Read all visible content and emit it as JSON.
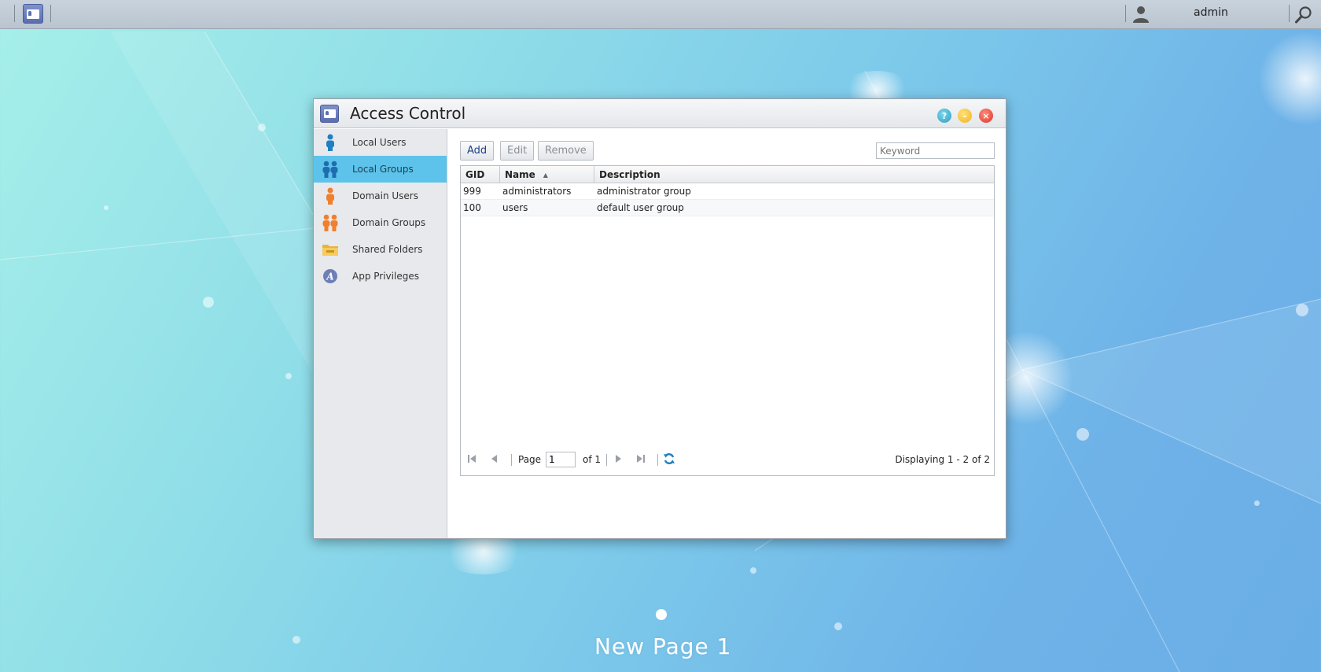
{
  "taskbar": {
    "username": "admin",
    "app_icon": "access-control-icon",
    "user_icon": "user-icon",
    "search_icon": "search-icon"
  },
  "window": {
    "title": "Access Control",
    "controls": [
      "help",
      "minimize",
      "close"
    ]
  },
  "sidebar": {
    "items": [
      {
        "label": "Local Users",
        "icon": "user-icon",
        "active": false
      },
      {
        "label": "Local Groups",
        "icon": "group-icon",
        "active": true
      },
      {
        "label": "Domain Users",
        "icon": "domain-user-icon",
        "active": false
      },
      {
        "label": "Domain Groups",
        "icon": "domain-group-icon",
        "active": false
      },
      {
        "label": "Shared Folders",
        "icon": "folder-icon",
        "active": false
      },
      {
        "label": "App Privileges",
        "icon": "app-icon",
        "active": false
      }
    ]
  },
  "toolbar": {
    "add_label": "Add",
    "edit_label": "Edit",
    "remove_label": "Remove",
    "keyword_placeholder": "Keyword"
  },
  "grid": {
    "columns": [
      "GID",
      "Name",
      "Description"
    ],
    "rows": [
      {
        "gid": "999",
        "name": "administrators",
        "description": "administrator group"
      },
      {
        "gid": "100",
        "name": "users",
        "description": "default user group"
      }
    ]
  },
  "pager": {
    "page_label": "Page",
    "page_value": "1",
    "of_label": "of 1",
    "displaying": "Displaying 1 - 2 of 2"
  },
  "desktop": {
    "page_name": "New Page 1"
  },
  "colors": {
    "active_item": "#5ec3ea",
    "user_icon_blue": "#1f7fc4",
    "domain_icon_orange": "#f07f2e"
  }
}
